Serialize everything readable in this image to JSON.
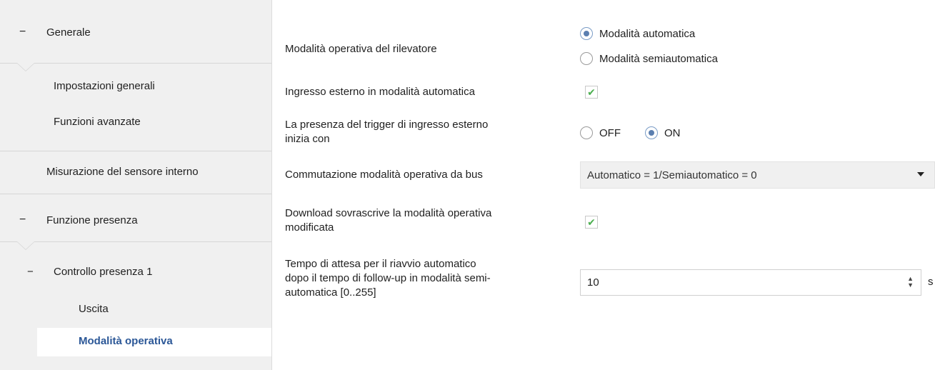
{
  "sidebar": {
    "generale": {
      "toggle": "−",
      "label": "Generale"
    },
    "impostazioni": "Impostazioni generali",
    "funzioni_avanzate": "Funzioni avanzate",
    "misurazione": "Misurazione del sensore interno",
    "funzione_presenza": {
      "toggle": "−",
      "label": "Funzione presenza"
    },
    "controllo_presenza": {
      "toggle": "−",
      "label": "Controllo presenza 1"
    },
    "uscita": "Uscita",
    "modalita_operativa": "Modalità operativa"
  },
  "params": {
    "rilevatore": {
      "label": "Modalità operativa del rilevatore",
      "options": [
        "Modalità automatica",
        "Modalità semiautomatica"
      ],
      "selected": "Modalità automatica"
    },
    "ingresso_esterno": {
      "label": "Ingresso esterno in modalità automatica",
      "checked": true
    },
    "trigger": {
      "label_line1": "La presenza del trigger di ingresso esterno",
      "label_line2": "inizia con",
      "options": [
        "OFF",
        "ON"
      ],
      "selected": "ON"
    },
    "commutazione": {
      "label": "Commutazione modalità operativa da bus",
      "value": "Automatico = 1/Semiautomatico = 0"
    },
    "download": {
      "label_line1": "Download sovrascrive la modalità operativa",
      "label_line2": "modificata",
      "checked": true
    },
    "tempo_attesa": {
      "label_line1": "Tempo di attesa per il riavvio automatico",
      "label_line2": "dopo il tempo di follow-up in modalità semi-",
      "label_line3": "automatica [0..255]",
      "value": "10",
      "unit": "s"
    }
  },
  "colors": {
    "accent": "#2b5797",
    "check": "#4caf50",
    "sidebar_bg": "#f0f0f0"
  }
}
